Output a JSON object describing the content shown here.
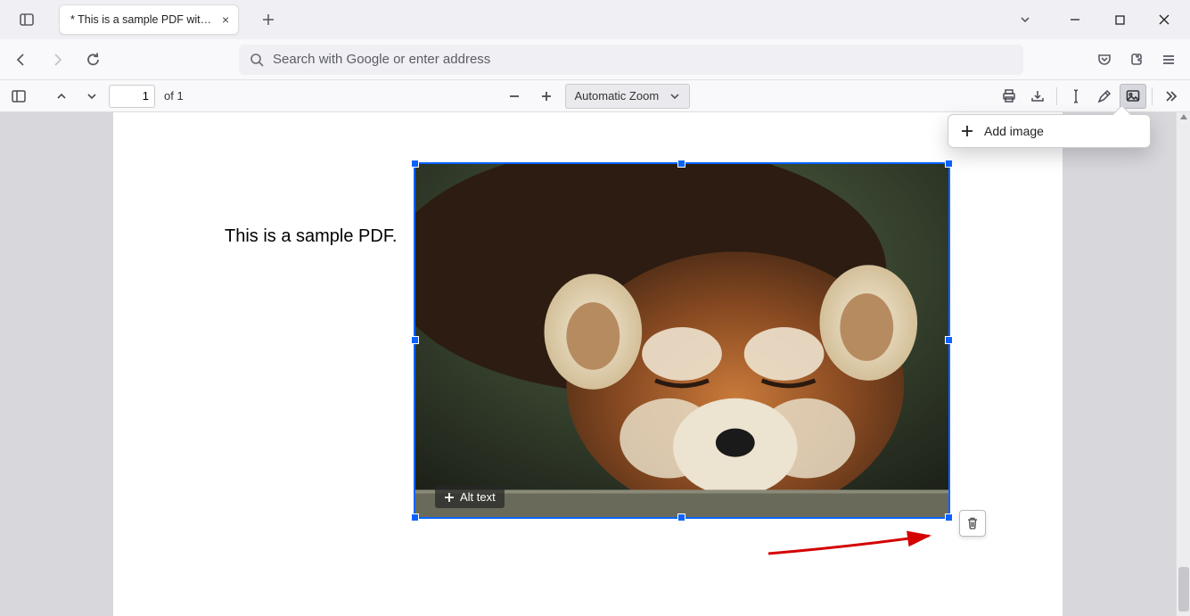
{
  "titlebar": {
    "tab_title": "* This is a sample PDF with an imag"
  },
  "address": {
    "placeholder": "Search with Google or enter address"
  },
  "pdf": {
    "page_current": "1",
    "page_of": "of 1",
    "zoom_label": "Automatic Zoom"
  },
  "popup": {
    "add_image": "Add image"
  },
  "page_body": {
    "text": "This is a sample PDF."
  },
  "image_editor": {
    "alt_text": "Alt text"
  },
  "icons": {
    "sidebar_panel": "sidebar-panel-icon",
    "back": "back-icon",
    "forward": "forward-icon",
    "reload": "reload-icon",
    "search": "search-icon",
    "pocket": "pocket-icon",
    "extensions": "extensions-icon",
    "menu": "menu-icon",
    "toggle_sidebar": "toggle-sidebar-icon",
    "prev_page": "chevron-up-icon",
    "next_page": "chevron-down-icon",
    "zoom_out": "minus-icon",
    "zoom_in": "plus-icon",
    "print": "print-icon",
    "download": "download-icon",
    "text_tool": "text-cursor-icon",
    "draw_tool": "pencil-icon",
    "image_tool": "image-icon",
    "more_tools": "chevrons-right-icon",
    "trash": "trash-icon",
    "tabs_dropdown": "chevron-down-icon",
    "minimize": "minimize-icon",
    "maximize": "maximize-icon",
    "close_window": "close-icon"
  }
}
